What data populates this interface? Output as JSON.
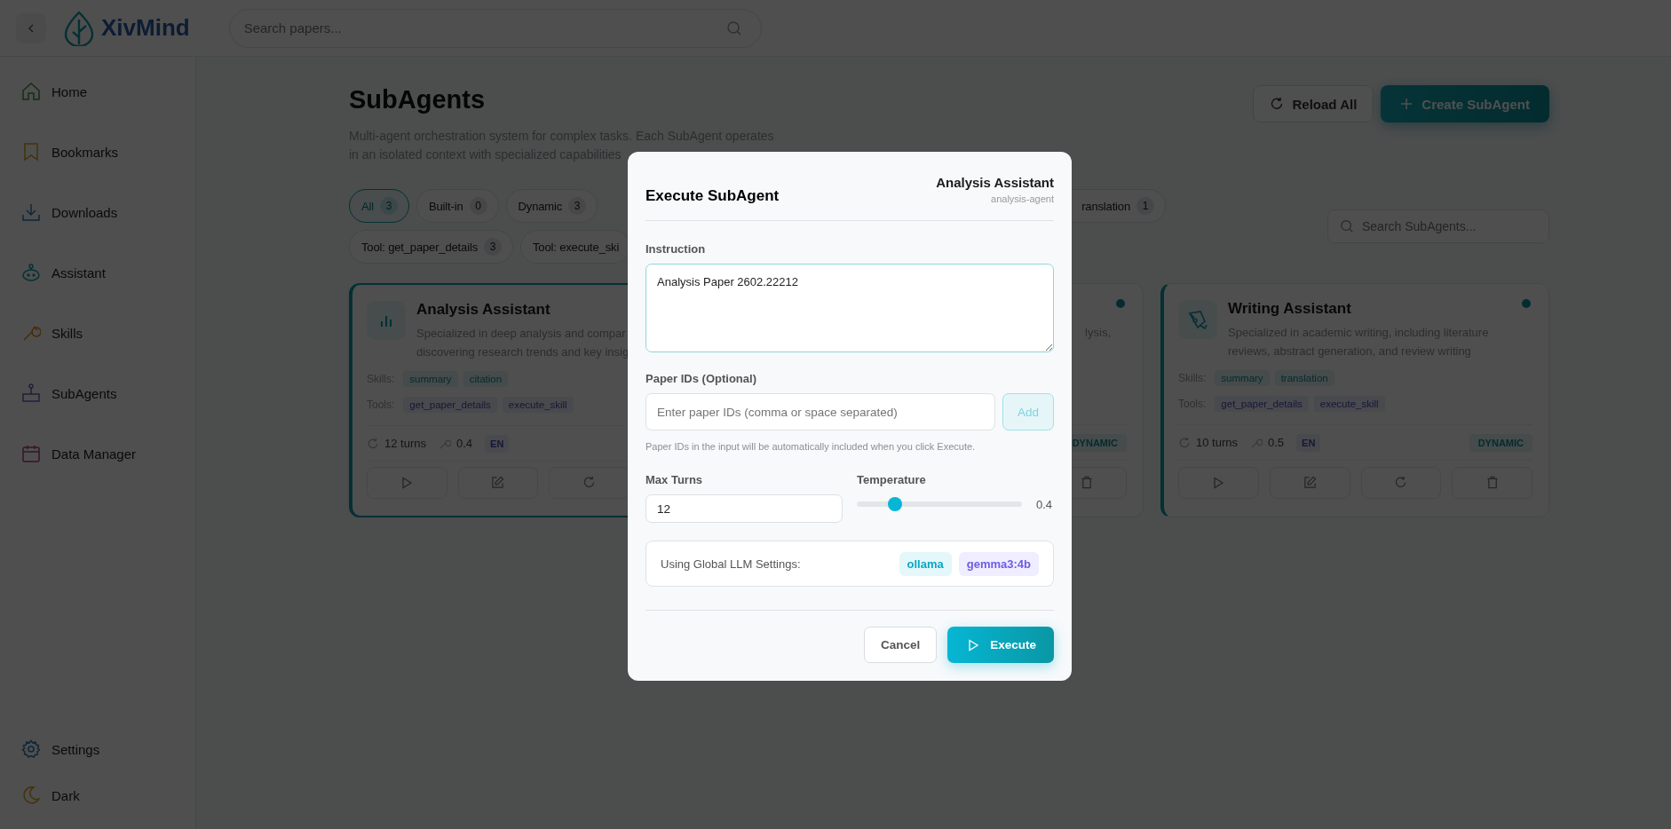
{
  "header": {
    "logo": "XivMind",
    "search": {
      "placeholder": "Search papers..."
    }
  },
  "sidebar": {
    "items": [
      {
        "label": "Home",
        "selected": false
      },
      {
        "label": "Bookmarks",
        "selected": false
      },
      {
        "label": "Downloads",
        "selected": false
      },
      {
        "label": "Assistant",
        "selected": false
      },
      {
        "label": "Skills",
        "selected": false
      },
      {
        "label": "SubAgents",
        "selected": false
      },
      {
        "label": "Data Manager",
        "selected": false
      }
    ],
    "footer": [
      {
        "label": "Settings"
      },
      {
        "label": "Dark"
      }
    ]
  },
  "page": {
    "title": "SubAgents",
    "description": [
      "Multi-agent orchestration system for complex tasks. Each SubAgent operates",
      "in an isolated context with specialized capabilities"
    ],
    "actions": [
      {
        "label": "Reload All",
        "kind": "secondary"
      },
      {
        "label": "Create SubAgent",
        "kind": "primary"
      }
    ]
  },
  "filters": {
    "rows": [
      {
        "chips": [
          {
            "label": "All",
            "count": "3",
            "selected": true
          },
          {
            "label": "Built-in",
            "count": "0",
            "selected": false
          },
          {
            "label": "Dynamic",
            "count": "3",
            "selected": false
          },
          {
            "label": "ranslation",
            "count": "1",
            "selected": false,
            "kind": "covered"
          }
        ]
      },
      {
        "chips": [
          {
            "label": "Tool: get_paper_details",
            "count": "3",
            "selected": false
          },
          {
            "label": "Tool: execute_ski",
            "selected": false
          }
        ]
      }
    ],
    "search": {
      "placeholder": "Search SubAgents..."
    }
  },
  "cards": [
    {
      "kind": "full",
      "selected": true,
      "title": "Analysis Assistant",
      "description": [
        "Specialized in deep analysis and compar",
        "discovering research trends and key insig"
      ],
      "skills_label": "Skills:",
      "skills": [
        "summary",
        "citation"
      ],
      "tools_label": "Tools:",
      "tools": [
        "get_paper_details",
        "execute_skill"
      ],
      "turns": "12 turns",
      "temperature": "0.4",
      "language": "EN",
      "actions": [
        {
          "kind": "run"
        },
        {
          "kind": "edit"
        },
        {
          "kind": "reload"
        }
      ]
    },
    {
      "kind": "covered",
      "selected": false,
      "active": true,
      "description": [
        "lysis,"
      ],
      "badge": "DYNAMIC",
      "actions": [
        {
          "kind": "delete"
        }
      ]
    },
    {
      "kind": "full",
      "selected": false,
      "active": true,
      "title": "Writing Assistant",
      "description": [
        "Specialized in academic writing, including literature",
        "reviews, abstract generation, and review writing"
      ],
      "skills_label": "Skills:",
      "skills": [
        "summary",
        "translation"
      ],
      "tools_label": "Tools:",
      "tools": [
        "get_paper_details",
        "execute_skill"
      ],
      "turns": "10 turns",
      "temperature": "0.5",
      "language": "EN",
      "badge": "DYNAMIC",
      "actions": [
        {
          "kind": "run"
        },
        {
          "kind": "edit"
        },
        {
          "kind": "reload"
        },
        {
          "kind": "delete"
        }
      ]
    }
  ],
  "modal": {
    "title": "Execute SubAgent",
    "agent_name": "Analysis Assistant",
    "agent_id": "analysis-agent",
    "instruction": {
      "label": "Instruction",
      "value": "Analysis Paper 2602.22212"
    },
    "paper_ids": {
      "label": "Paper IDs (Optional)",
      "placeholder": "Enter paper IDs (comma or space separated)",
      "button": "Add",
      "disabled": true,
      "hint": "Paper IDs in the input will be automatically included when you click Execute."
    },
    "max_turns": {
      "label": "Max Turns",
      "value": "12"
    },
    "temperature": {
      "label": "Temperature",
      "level": 0.2,
      "reading": "0.4"
    },
    "llm": {
      "label": "Using Global LLM Settings:",
      "provider": "ollama",
      "model": "gemma3:4b"
    },
    "buttons": [
      {
        "label": "Cancel",
        "kind": "secondary"
      },
      {
        "label": "Execute",
        "kind": "primary"
      }
    ]
  }
}
